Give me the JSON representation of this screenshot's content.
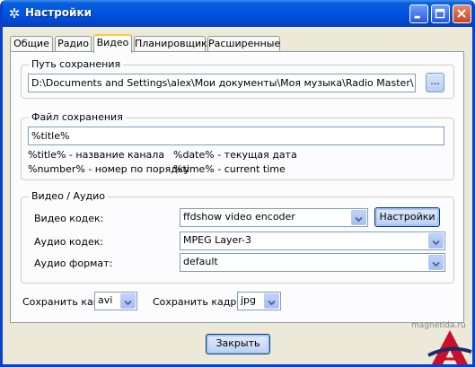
{
  "window": {
    "title": "Настройки"
  },
  "tabs": [
    {
      "label": "Общие"
    },
    {
      "label": "Радио"
    },
    {
      "label": "Видео"
    },
    {
      "label": "Планировщик"
    },
    {
      "label": "Расширенные"
    }
  ],
  "save_path": {
    "legend": "Путь сохранения",
    "value": "D:\\Documents and Settings\\alex\\Мои документы\\Моя музыка\\Radio Master\\",
    "browse_label": "..."
  },
  "save_file": {
    "legend": "Файл сохранения",
    "value": "%title%",
    "hints": [
      "%title% - название канала",
      "%date% - текущая дата",
      "%number% - номер по порядку",
      "%time% - current time"
    ]
  },
  "video_audio": {
    "legend": "Видео / Аудио",
    "video_codec_label": "Видео кодек:",
    "video_codec_value": "ffdshow video encoder",
    "settings_button": "Настройки",
    "audio_codec_label": "Аудио кодек:",
    "audio_codec_value": "MPEG Layer-3",
    "audio_format_label": "Аудио формат:",
    "audio_format_value": "default"
  },
  "save_as": {
    "label": "Сохранить как:",
    "value": "avi"
  },
  "save_frame": {
    "label": "Сохранить кадр в:",
    "value": "jpg"
  },
  "close_button": "Закрыть",
  "watermark": "magnetida.ru"
}
